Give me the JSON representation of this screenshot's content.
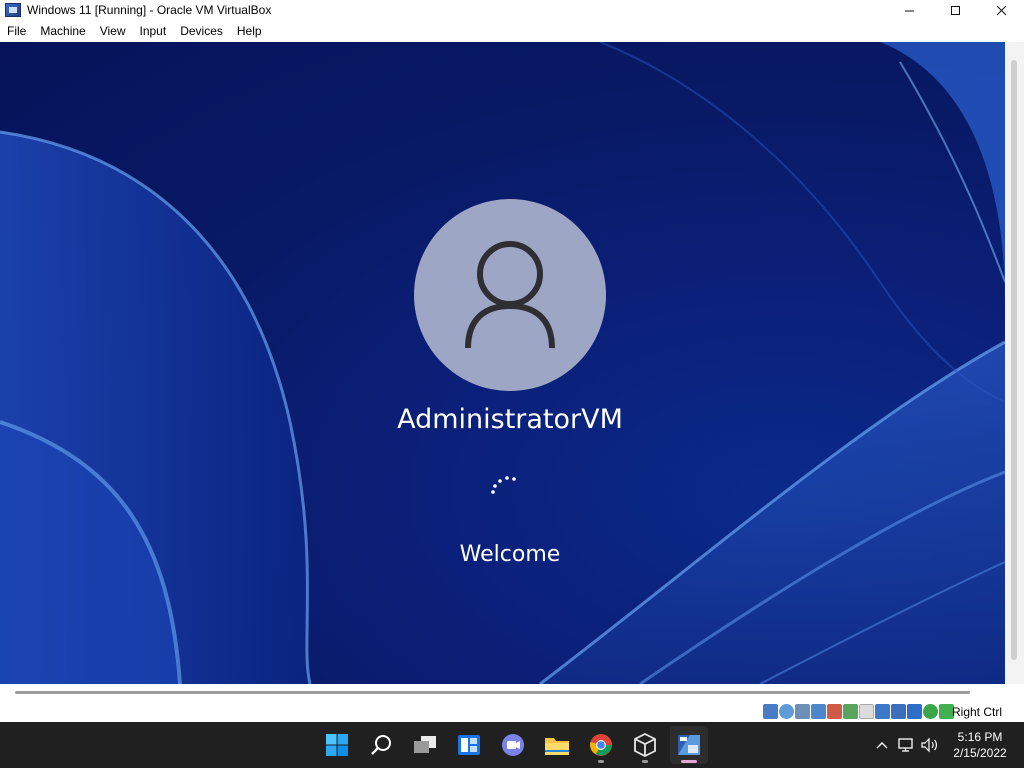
{
  "window": {
    "title": "Windows 11 [Running] - Oracle VM VirtualBox",
    "controls": [
      "minimize-icon",
      "maximize-icon",
      "close-icon"
    ]
  },
  "menu": [
    "File",
    "Machine",
    "View",
    "Input",
    "Devices",
    "Help"
  ],
  "vm_screen": {
    "username": "AdministratorVM",
    "status": "Welcome",
    "avatar_icon": "user-icon",
    "background_colors": [
      "#06135a",
      "#0b1f78",
      "#2a5fd1",
      "#5b8ee8"
    ]
  },
  "statusbar": {
    "icons": [
      "hard-disk-icon",
      "optical-drive-icon",
      "audio-icon",
      "network-icon",
      "usb-icon",
      "shared-folders-icon",
      "display-icon",
      "recording-icon",
      "cpu-icon",
      "mouse-integration-icon",
      "keyboard-capture-icon"
    ],
    "host_key": "Right Ctrl"
  },
  "taskbar": {
    "apps": [
      "start-icon",
      "search-icon",
      "task-view-icon",
      "widgets-icon",
      "teams-chat-icon",
      "file-explorer-icon",
      "chrome-icon",
      "virtualbox-icon",
      "windows11-vm-icon"
    ],
    "tray_icons": [
      "chevron-up-icon",
      "network-icon",
      "volume-icon"
    ],
    "time": "5:16 PM",
    "date": "2/15/2022"
  }
}
